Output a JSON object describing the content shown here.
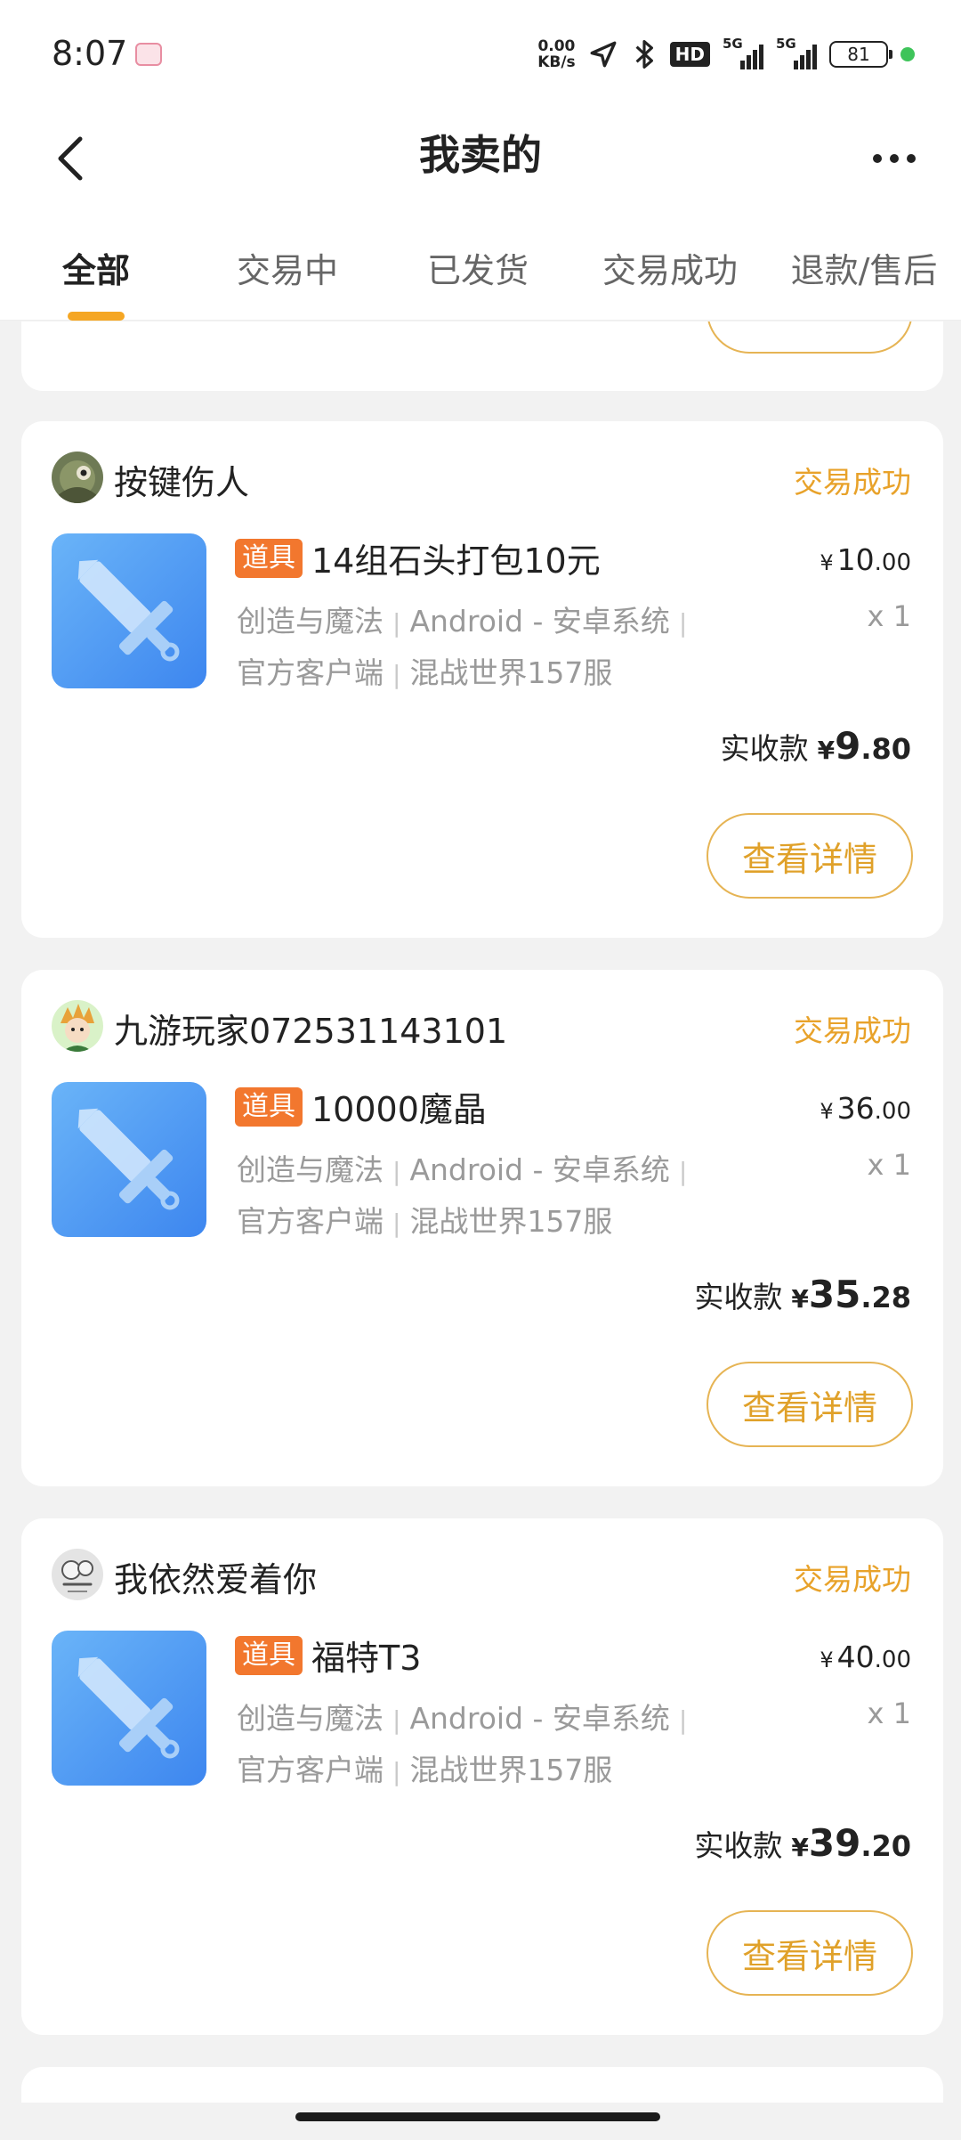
{
  "status_bar": {
    "time": "8:07",
    "net_speed_value": "0.00",
    "net_speed_unit": "KB/s",
    "hd_badge": "HD",
    "signal1_label": "5G",
    "signal2_label": "5G",
    "battery": "81"
  },
  "header": {
    "title": "我卖的",
    "back_icon": "chevron-left-icon",
    "more_icon": "more-dots-icon"
  },
  "tabs": [
    {
      "label": "全部",
      "active": true
    },
    {
      "label": "交易中",
      "active": false
    },
    {
      "label": "已发货",
      "active": false
    },
    {
      "label": "交易成功",
      "active": false
    },
    {
      "label": "退款/售后",
      "active": false
    }
  ],
  "detail_button_label": "查看详情",
  "received_label": "实收款",
  "currency_symbol": "¥",
  "orders": [
    {
      "seller": "按键伤人",
      "status": "交易成功",
      "tag": "道具",
      "title": "14组石头打包10元",
      "game": "创造与魔法",
      "platform": "Android - 安卓系统",
      "client": "官方客户端",
      "server": "混战世界157服",
      "price_int": "10",
      "price_dec": ".00",
      "quantity": "x 1",
      "received_int": "9",
      "received_dec": ".80"
    },
    {
      "seller": "九游玩家072531143101",
      "status": "交易成功",
      "tag": "道具",
      "title": "10000魔晶",
      "game": "创造与魔法",
      "platform": "Android - 安卓系统",
      "client": "官方客户端",
      "server": "混战世界157服",
      "price_int": "36",
      "price_dec": ".00",
      "quantity": "x 1",
      "received_int": "35",
      "received_dec": ".28"
    },
    {
      "seller": "我依然爱着你",
      "status": "交易成功",
      "tag": "道具",
      "title": "福特T3",
      "game": "创造与魔法",
      "platform": "Android - 安卓系统",
      "client": "官方客户端",
      "server": "混战世界157服",
      "price_int": "40",
      "price_dec": ".00",
      "quantity": "x 1",
      "received_int": "39",
      "received_dec": ".20"
    }
  ],
  "colors": {
    "accent": "#f5a623",
    "status_text": "#e8a22a",
    "tag_bg": "#f2772e",
    "button_border": "#e6b454",
    "product_image_start": "#6ab4f8",
    "product_image_end": "#3d86ef"
  }
}
